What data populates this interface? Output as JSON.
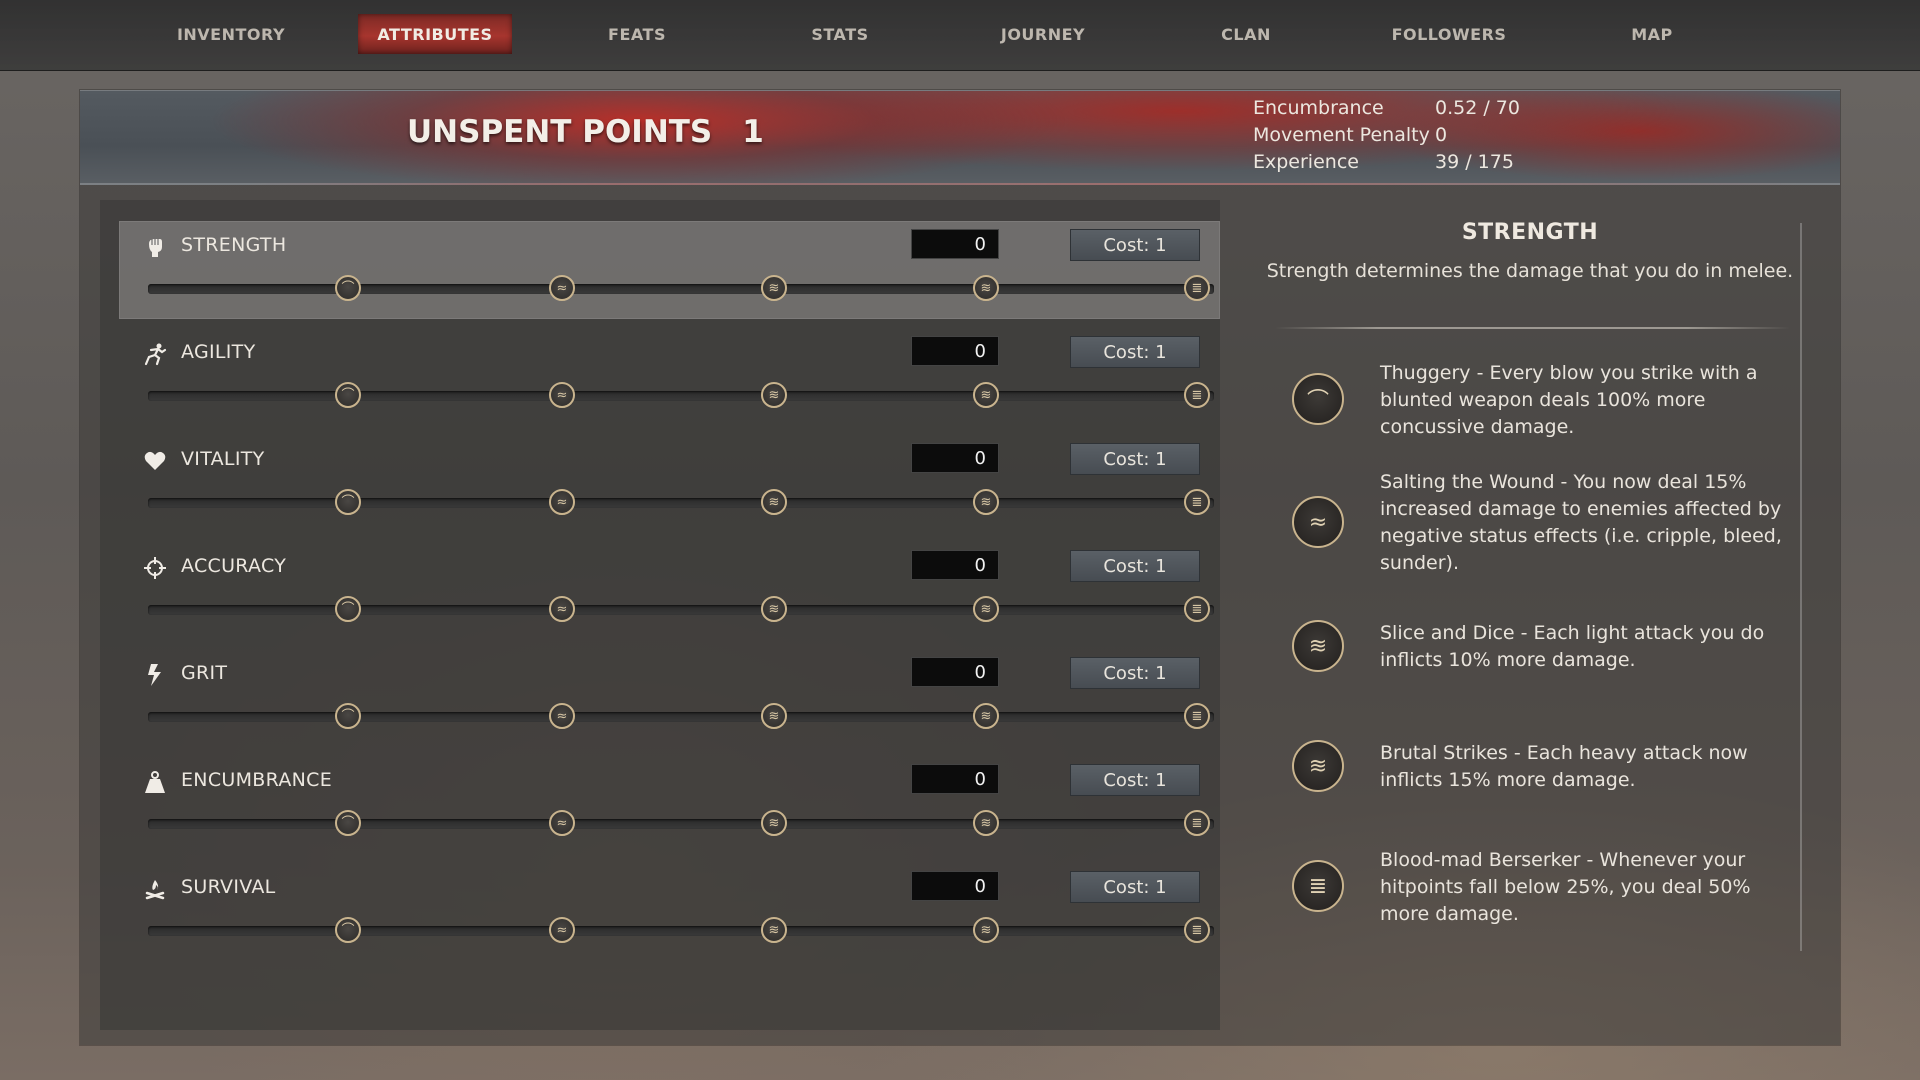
{
  "nav": {
    "tabs": [
      {
        "label": "INVENTORY",
        "active": false
      },
      {
        "label": "ATTRIBUTES",
        "active": true
      },
      {
        "label": "FEATS",
        "active": false
      },
      {
        "label": "STATS",
        "active": false
      },
      {
        "label": "JOURNEY",
        "active": false
      },
      {
        "label": "CLAN",
        "active": false
      },
      {
        "label": "FOLLOWERS",
        "active": false
      },
      {
        "label": "MAP",
        "active": false
      }
    ]
  },
  "header": {
    "unspent_label": "UNSPENT POINTS",
    "unspent_value": "1",
    "stats": [
      {
        "label": "Encumbrance",
        "value": "0.52 / 70"
      },
      {
        "label": "Movement Penalty",
        "value": "0"
      },
      {
        "label": "Experience",
        "value": "39 / 175"
      }
    ]
  },
  "attributes": [
    {
      "name": "STRENGTH",
      "icon": "fist-icon",
      "value": "0",
      "cost": "Cost: 1",
      "selected": true
    },
    {
      "name": "AGILITY",
      "icon": "running-figure-icon",
      "value": "0",
      "cost": "Cost: 1",
      "selected": false
    },
    {
      "name": "VITALITY",
      "icon": "heart-icon",
      "value": "0",
      "cost": "Cost: 1",
      "selected": false
    },
    {
      "name": "ACCURACY",
      "icon": "crosshair-icon",
      "value": "0",
      "cost": "Cost: 1",
      "selected": false
    },
    {
      "name": "GRIT",
      "icon": "lightning-icon",
      "value": "0",
      "cost": "Cost: 1",
      "selected": false
    },
    {
      "name": "ENCUMBRANCE",
      "icon": "weight-sack-icon",
      "value": "0",
      "cost": "Cost: 1",
      "selected": false
    },
    {
      "name": "SURVIVAL",
      "icon": "campfire-icon",
      "value": "0",
      "cost": "Cost: 1",
      "selected": false
    }
  ],
  "milestones": {
    "count": 5,
    "icons": [
      "perk-tier-1-icon",
      "perk-tier-2-icon",
      "perk-tier-3-icon",
      "perk-tier-4-icon",
      "perk-tier-5-icon"
    ]
  },
  "detail": {
    "title": "STRENGTH",
    "description": "Strength determines the damage that you do in melee.",
    "perks": [
      {
        "icon": "perk-tier-1-icon",
        "text": "Thuggery - Every blow you strike with a blunted weapon deals 100% more concussive damage."
      },
      {
        "icon": "perk-tier-2-icon",
        "text": "Salting the Wound - You now deal 15% increased damage to enemies affected by negative status effects (i.e. cripple, bleed, sunder)."
      },
      {
        "icon": "perk-tier-3-icon",
        "text": "Slice and Dice - Each light attack you do inflicts 10% more damage."
      },
      {
        "icon": "perk-tier-4-icon",
        "text": "Brutal Strikes - Each heavy attack now inflicts 15% more damage."
      },
      {
        "icon": "perk-tier-5-icon",
        "text": "Blood-mad Berserker - Whenever your hitpoints fall below 25%, you deal 50% more damage."
      }
    ]
  },
  "colors": {
    "active_tab": "#a7352e",
    "banner_red": "#be2d26",
    "node_ring": "#c9b48e"
  }
}
